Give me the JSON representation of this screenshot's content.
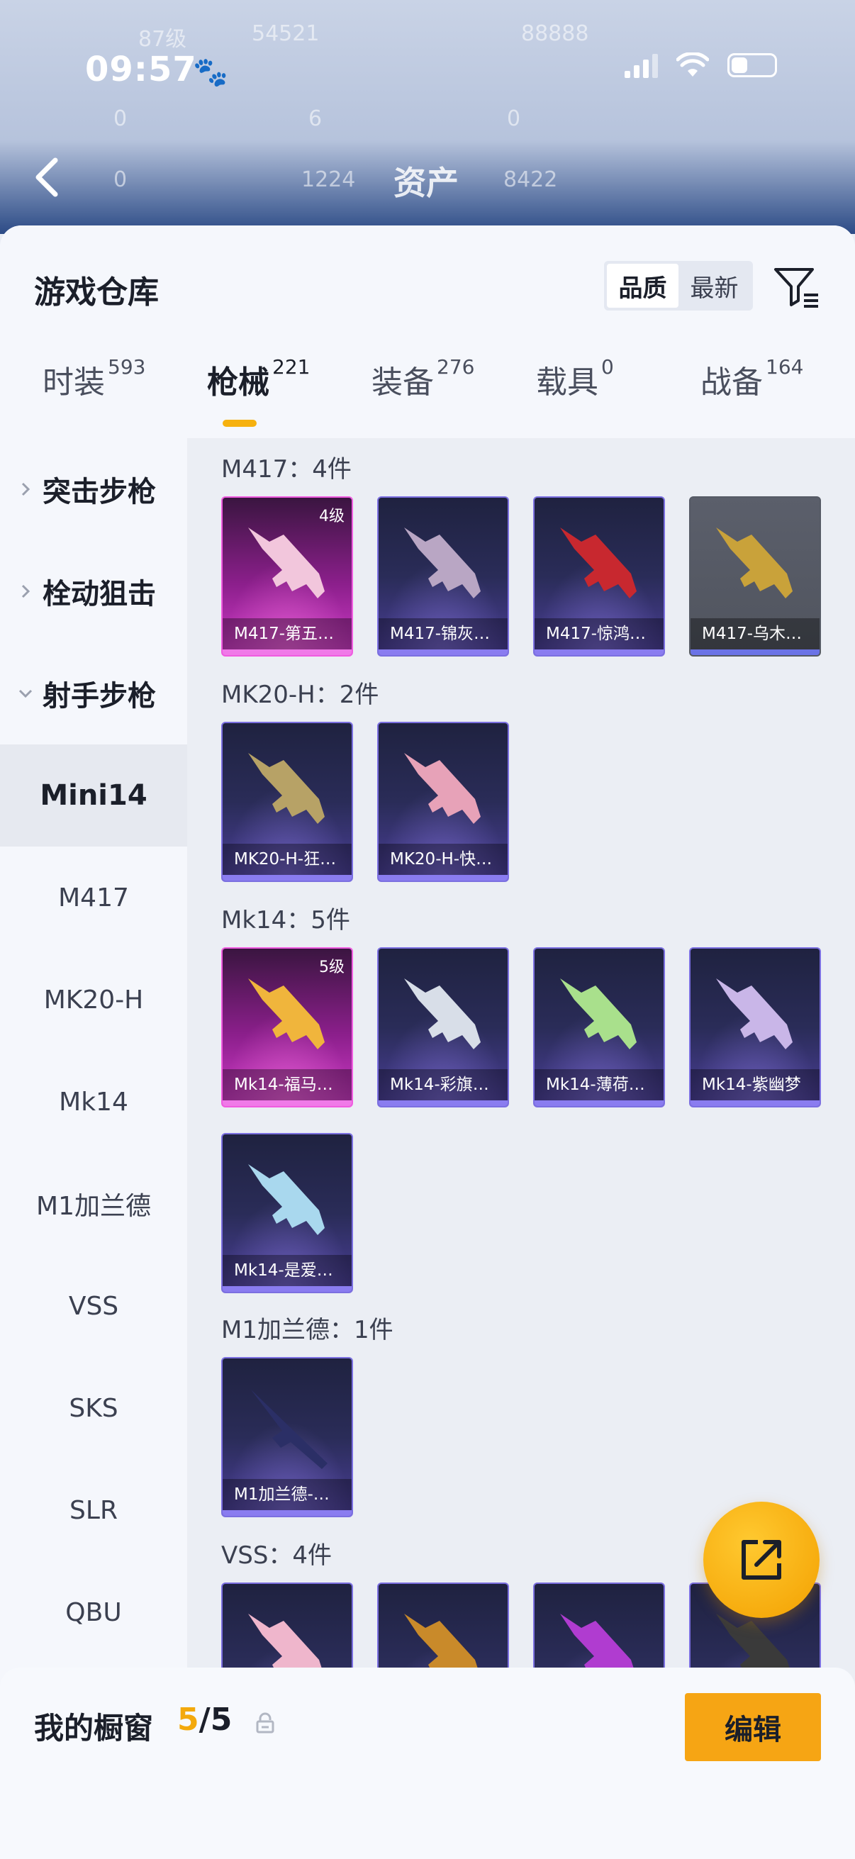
{
  "status_bar": {
    "time": "09:57"
  },
  "background": {
    "title": "资产",
    "ghost_texts": [
      "87级",
      "54521",
      "88888",
      "0",
      "6",
      "0",
      "0",
      "1224",
      "8422"
    ]
  },
  "sheet": {
    "title": "游戏仓库",
    "sort_options": [
      "品质",
      "最新"
    ],
    "active_sort": "品质"
  },
  "tabs": [
    {
      "label": "时装",
      "count": "593"
    },
    {
      "label": "枪械",
      "count": "221",
      "active": true
    },
    {
      "label": "装备",
      "count": "276"
    },
    {
      "label": "载具",
      "count": "0"
    },
    {
      "label": "战备",
      "count": "164"
    }
  ],
  "sidebar": {
    "categories": [
      {
        "label": "突击步枪",
        "expanded": false
      },
      {
        "label": "栓动狙击",
        "expanded": false
      },
      {
        "label": "射手步枪",
        "expanded": true
      }
    ],
    "subitems": [
      "Mini14",
      "M417",
      "MK20-H",
      "Mk14",
      "M1加兰德",
      "VSS",
      "SKS",
      "SLR",
      "QBU"
    ],
    "active_subitem": "Mini14"
  },
  "groups": [
    {
      "title": "M417：4件",
      "items": [
        {
          "label": "M417-第五…",
          "level": "4级",
          "rarity": "pink"
        },
        {
          "label": "M417-锦灰…",
          "rarity": "purple"
        },
        {
          "label": "M417-惊鸿…",
          "rarity": "purple"
        },
        {
          "label": "M417-乌木…",
          "rarity": "gray"
        }
      ]
    },
    {
      "title": "MK20-H：2件",
      "items": [
        {
          "label": "MK20-H-狂…",
          "rarity": "purple"
        },
        {
          "label": "MK20-H-快…",
          "rarity": "purple"
        }
      ]
    },
    {
      "title": "Mk14：5件",
      "items": [
        {
          "label": "Mk14-福马…",
          "level": "5级",
          "rarity": "pink"
        },
        {
          "label": "Mk14-彩旗…",
          "rarity": "purple"
        },
        {
          "label": "Mk14-薄荷…",
          "rarity": "purple"
        },
        {
          "label": "Mk14-紫幽梦",
          "rarity": "purple"
        },
        {
          "label": "Mk14-是爱…",
          "rarity": "purple"
        }
      ]
    },
    {
      "title": "M1加兰德：1件",
      "items": [
        {
          "label": "M1加兰德-…",
          "rarity": "purple"
        }
      ]
    },
    {
      "title": "VSS：4件",
      "items": [
        {
          "label": "",
          "rarity": "purple"
        },
        {
          "label": "",
          "rarity": "purple"
        },
        {
          "label": "",
          "rarity": "purple"
        },
        {
          "label": "",
          "rarity": "purple"
        }
      ]
    }
  ],
  "bottom_bar": {
    "title": "我的橱窗",
    "count_current": "5",
    "count_total": "/5",
    "edit_label": "编辑"
  },
  "colors": {
    "accent": "#f6a514",
    "pink_rarity": "#d03cc8",
    "purple_rarity": "#4b3f99"
  },
  "icons": [
    "back-arrow-icon",
    "paw-icon",
    "signal-icon",
    "wifi-icon",
    "battery-icon",
    "filter-icon",
    "chevron-right-icon",
    "chevron-down-icon",
    "share-icon",
    "lock-icon"
  ]
}
